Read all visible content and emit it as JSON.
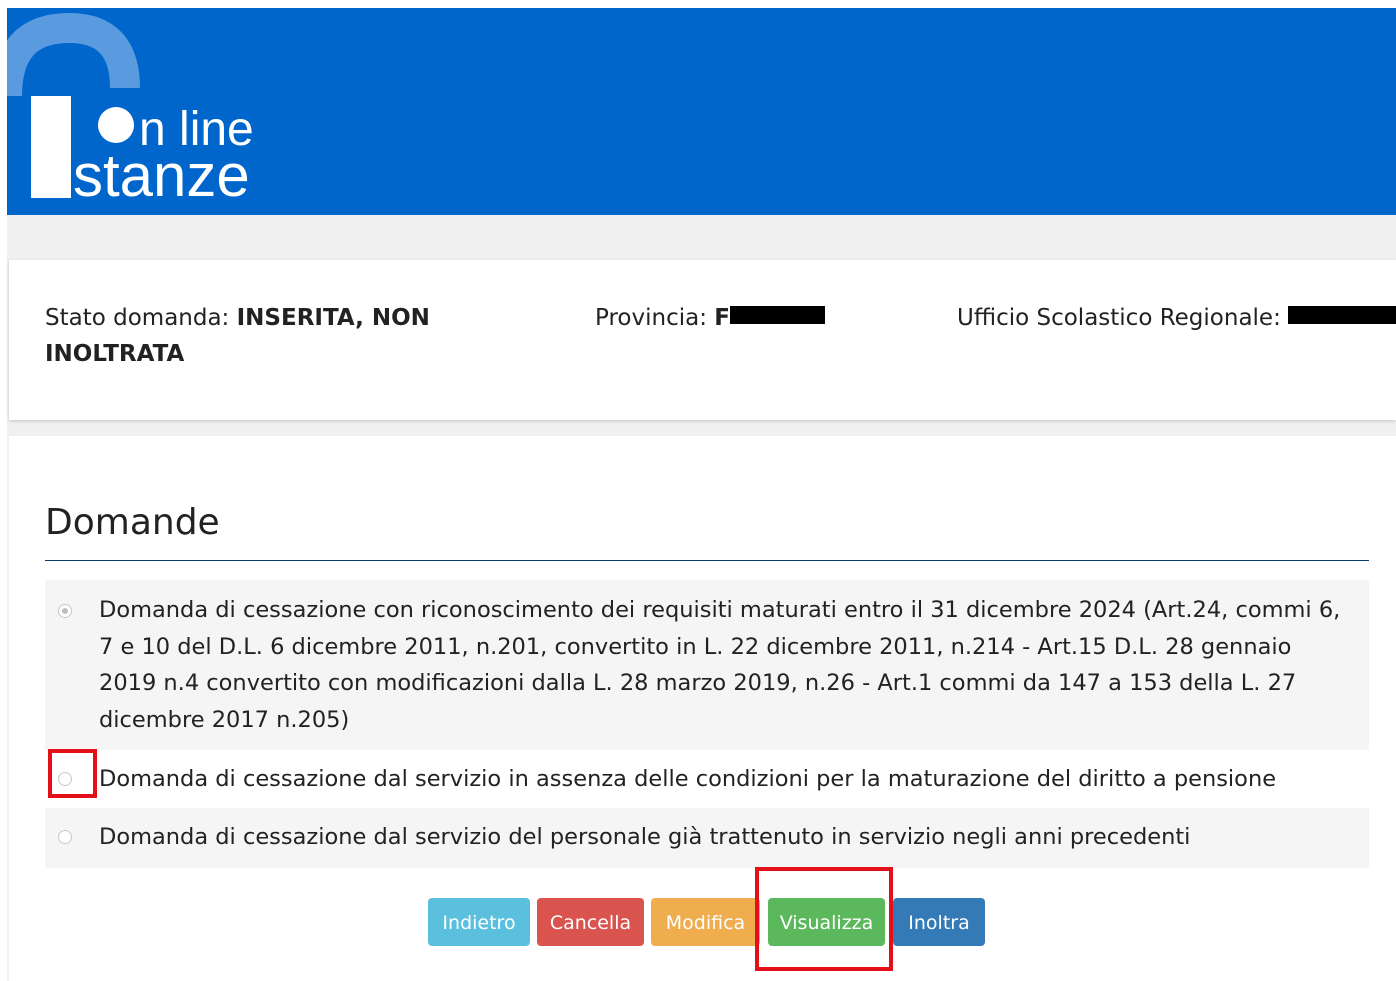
{
  "header": {
    "logo_line1": "n line",
    "logo_line2": "stanze",
    "bg_color": "#0066cc"
  },
  "status": {
    "stato_label": "Stato domanda: ",
    "stato_value_line1": "INSERITA, NON",
    "stato_value_line2": "INOLTRATA",
    "provincia_label": "Provincia: ",
    "provincia_visible": "F",
    "usr_label": "Ufficio Scolastico Regionale: "
  },
  "main": {
    "title": "Domande",
    "options": [
      {
        "text": "Domanda di cessazione con riconoscimento dei requisiti maturati entro il 31 dicembre 2024 (Art.24, commi 6, 7 e 10 del D.L. 6 dicembre 2011, n.201, convertito in L. 22 dicembre 2011, n.214 - Art.15 D.L. 28 gennaio 2019 n.4 convertito con modificazioni dalla L. 28 marzo 2019, n.26 - Art.1 commi da 147 a 153 della L. 27 dicembre 2017 n.205)",
        "checked": true
      },
      {
        "text": "Domanda di cessazione dal servizio in assenza delle condizioni per la maturazione del diritto a pensione",
        "checked": false
      },
      {
        "text": "Domanda di cessazione dal servizio del personale già trattenuto in servizio negli anni precedenti",
        "checked": false
      }
    ],
    "buttons": {
      "indietro": "Indietro",
      "cancella": "Cancella",
      "modifica": "Modifica",
      "visualizza": "Visualizza",
      "inoltra": "Inoltra"
    }
  },
  "colors": {
    "indietro": "#5bc0de",
    "cancella": "#d9534f",
    "modifica": "#f0ad4e",
    "visualizza": "#5cb85c",
    "inoltra": "#337ab7",
    "highlight": "#e3101a"
  }
}
